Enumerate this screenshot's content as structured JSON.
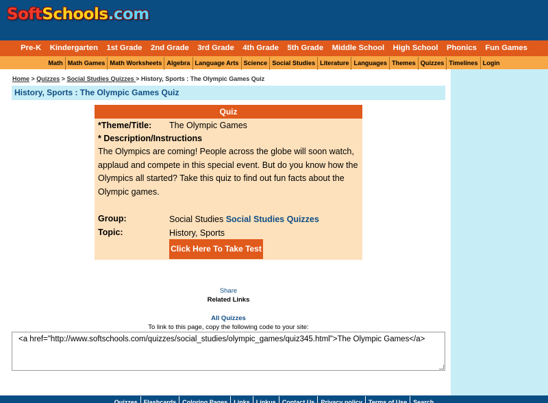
{
  "logo": {
    "part1": "Soft",
    "part2": "Schools",
    "part3": ".com"
  },
  "nav_main": [
    "Pre-K",
    "Kindergarten",
    "1st Grade",
    "2nd Grade",
    "3rd Grade",
    "4th Grade",
    "5th Grade",
    "Middle School",
    "High School",
    "Phonics",
    "Fun Games"
  ],
  "nav_sub": [
    "Math",
    "Math Games",
    "Math Worksheets",
    "Algebra",
    "Language Arts",
    "Science",
    "Social Studies",
    "Literature",
    "Languages",
    "Themes",
    "Quizzes",
    "Timelines",
    "Login"
  ],
  "breadcrumb": {
    "home": "Home",
    "sep": " > ",
    "quizzes": "Quizzes",
    "social": "Social Studies Quizzes ",
    "current": "> History, Sports : The Olympic Games Quiz"
  },
  "page_title": "History, Sports : The Olympic Games Quiz",
  "quiz": {
    "header": "Quiz",
    "theme_label": "*Theme/Title:",
    "theme_value": "The Olympic Games",
    "desc_label": "* Description/Instructions",
    "description": "The Olympics are coming! People across the globe will soon watch, applaud and compete in this special event. But do you know how the Olympics all started? Take this quiz to find out fun facts about the Olympic games.",
    "group_label": "Group:",
    "group_value": "Social Studies ",
    "group_link": "Social Studies Quizzes",
    "topic_label": "Topic:",
    "topic_value": "History, Sports",
    "take_test": "Click Here To Take Test"
  },
  "share": "Share",
  "related_links": "Related Links",
  "all_quizzes": "All Quizzes",
  "link_instructions": "To link to this page, copy the following code to your site:",
  "link_code": "<a href=\"http://www.softschools.com/quizzes/social_studies/olympic_games/quiz345.html\">The Olympic Games</a>",
  "footer": [
    "Quizzes",
    "Flashcards",
    "Coloring Pages",
    "Links",
    "Linkus",
    "Contact Us",
    "Privacy policy",
    "Terms of Use",
    "Search"
  ],
  "colors": {
    "header_blue": "#0a4d83",
    "nav_orange": "#e05a1c",
    "subnav_orange": "#f7a745",
    "light_blue": "#c7edf6",
    "quiz_bg": "#fde1bc"
  }
}
